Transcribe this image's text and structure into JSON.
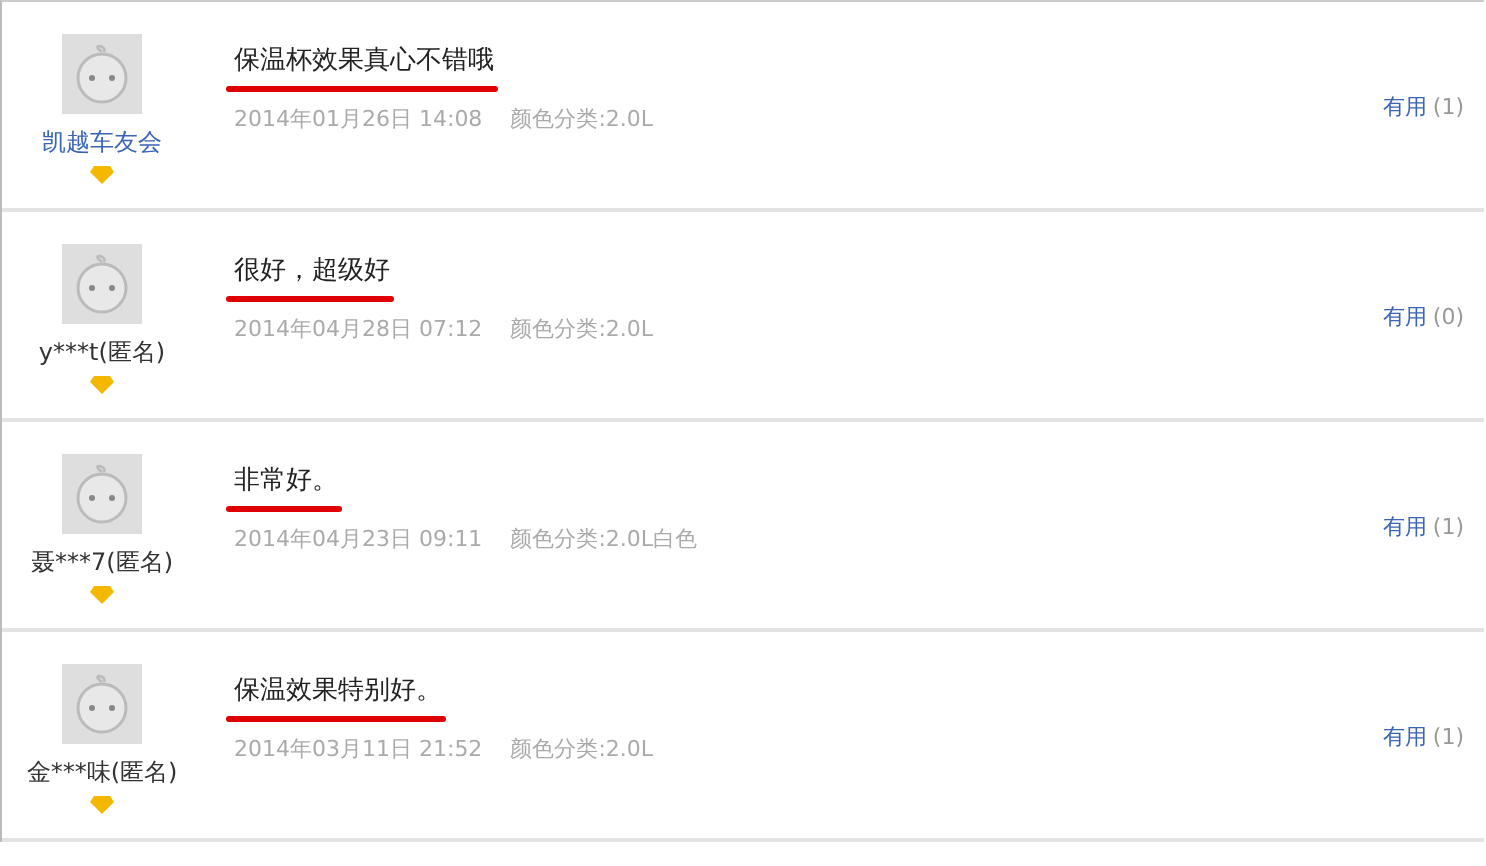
{
  "reviews": [
    {
      "user": "凯越车友会",
      "linked": true,
      "comment": "保温杯效果真心不错哦",
      "date": "2014年01月26日 14:08",
      "variant": "颜色分类:2.0L",
      "helpful_label": "有用",
      "helpful_count": "(1)"
    },
    {
      "user": "y***t(匿名)",
      "linked": false,
      "comment": "很好，超级好",
      "date": "2014年04月28日 07:12",
      "variant": "颜色分类:2.0L",
      "helpful_label": "有用",
      "helpful_count": "(0)"
    },
    {
      "user": "聂***7(匿名)",
      "linked": false,
      "comment": "非常好。",
      "date": "2014年04月23日 09:11",
      "variant": "颜色分类:2.0L白色",
      "helpful_label": "有用",
      "helpful_count": "(1)"
    },
    {
      "user": "金***味(匿名)",
      "linked": false,
      "comment": "保温效果特别好。",
      "date": "2014年03月11日 21:52",
      "variant": "颜色分类:2.0L",
      "helpful_label": "有用",
      "helpful_count": "(1)"
    }
  ]
}
